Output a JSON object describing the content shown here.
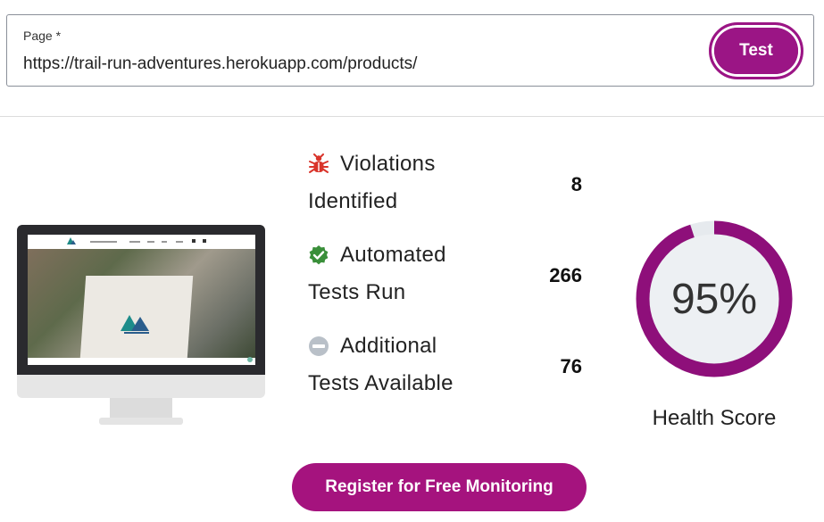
{
  "url_form": {
    "label": "Page *",
    "value": "https://trail-run-adventures.herokuapp.com/products/",
    "test_button": "Test"
  },
  "stats": [
    {
      "icon": "bug-icon",
      "label_line1": "Violations",
      "label_line2": "Identified",
      "value": "8",
      "color": "#d9342b"
    },
    {
      "icon": "check-badge-icon",
      "label_line1": "Automated",
      "label_line2": "Tests Run",
      "value": "266",
      "color": "#3a8f3a"
    },
    {
      "icon": "minus-circle-icon",
      "label_line1": "Additional",
      "label_line2": "Tests Available",
      "value": "76",
      "color": "#b9c0c8"
    }
  ],
  "health": {
    "score_text": "95%",
    "score": 95,
    "label": "Health Score",
    "ring_color": "#8e0f7a",
    "track_color": "#e6eaee"
  },
  "register_button": "Register for Free Monitoring",
  "colors": {
    "accent": "#9b1585"
  }
}
